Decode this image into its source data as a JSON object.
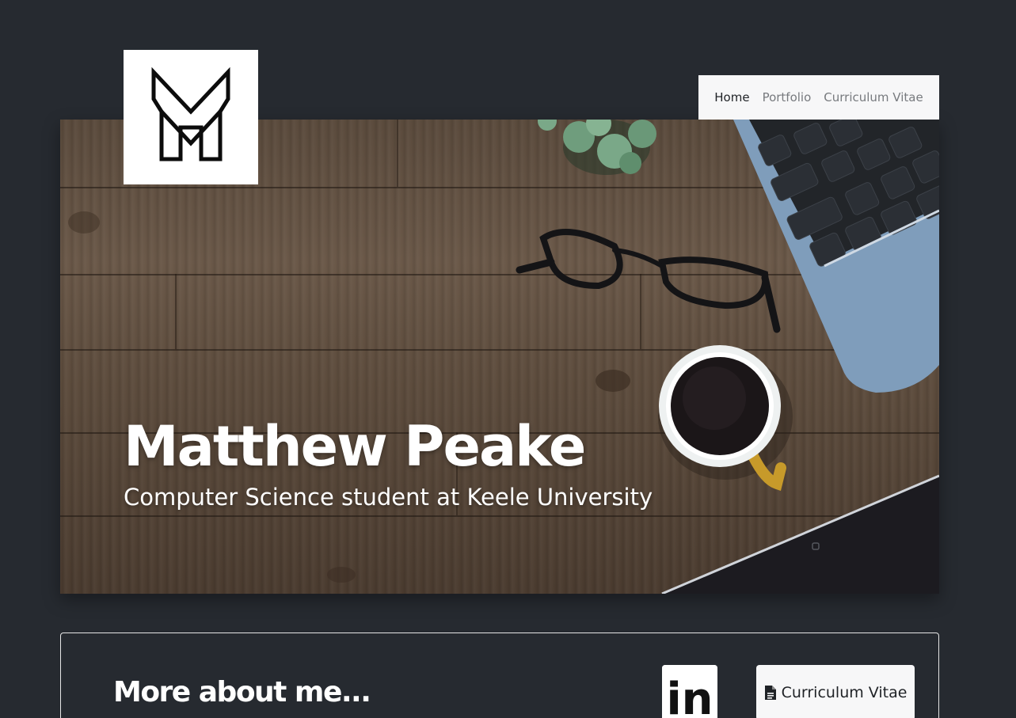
{
  "brand": {
    "logo_letter": "M"
  },
  "nav": {
    "items": [
      {
        "label": "Home",
        "active": true
      },
      {
        "label": "Portfolio",
        "active": false
      },
      {
        "label": "Curriculum Vitae",
        "active": false
      }
    ]
  },
  "hero": {
    "title": "Matthew Peake",
    "subtitle": "Computer Science student at Keele University"
  },
  "about": {
    "title": "More about me...",
    "linkedin_text": "in",
    "cv_button_label": "Curriculum Vitae"
  },
  "colors": {
    "background": "#262a30",
    "nav_bg": "#f7f7f8",
    "nav_active": "#1f2226",
    "nav_inactive": "#777a7e",
    "hero_text": "#ffffff"
  },
  "icons": [
    "linkedin-icon",
    "document-icon"
  ]
}
